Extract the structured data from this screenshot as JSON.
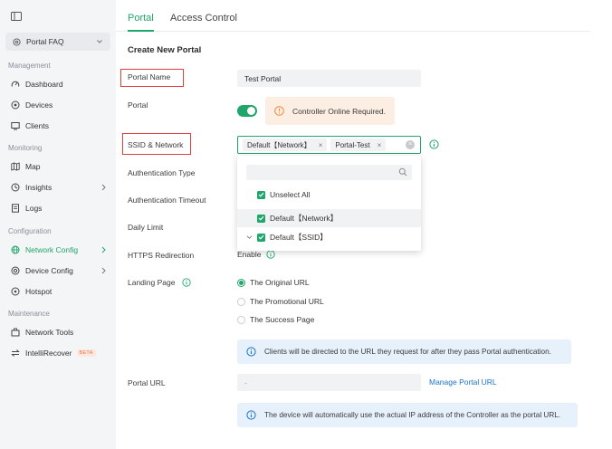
{
  "sidebar": {
    "site": "Portal FAQ",
    "sections": {
      "management": "Management",
      "monitoring": "Monitoring",
      "configuration": "Configuration",
      "maintenance": "Maintenance"
    },
    "items": {
      "dashboard": "Dashboard",
      "devices": "Devices",
      "clients": "Clients",
      "map": "Map",
      "insights": "Insights",
      "logs": "Logs",
      "network_config": "Network Config",
      "device_config": "Device Config",
      "hotspot": "Hotspot",
      "network_tools": "Network Tools",
      "intellirecover": "IntelliRecover",
      "beta": "BETA"
    },
    "active_color": "#1fa66a"
  },
  "tabs": {
    "portal": "Portal",
    "access_control": "Access Control"
  },
  "page_title": "Create New Portal",
  "form": {
    "portal_name_label": "Portal Name",
    "portal_name_value": "Test Portal",
    "portal_label": "Portal",
    "portal_enabled": true,
    "warning": "Controller Online Required.",
    "ssid_label": "SSID & Network",
    "ssid_chips": [
      "Default【Network】",
      "Portal-Test"
    ],
    "auth_type_label": "Authentication Type",
    "auth_timeout_label": "Authentication Timeout",
    "daily_limit_label": "Daily Limit",
    "https_label": "HTTPS Redirection",
    "https_enable": "Enable",
    "landing_label": "Landing Page",
    "landing_options": [
      "The Original URL",
      "The Promotional URL",
      "The Success Page"
    ],
    "landing_selected": "The Original URL",
    "landing_note": "Clients will be directed to the URL they request for after they pass Portal authentication.",
    "portal_url_label": "Portal URL",
    "portal_url_value": "-",
    "manage_portal_url": "Manage Portal URL",
    "portal_url_note": "The device will automatically use the actual IP address of the Controller as the portal URL."
  },
  "dropdown": {
    "search_placeholder": "",
    "unselect_all": "Unselect All",
    "options": [
      "Default【Network】",
      "Default【SSID】"
    ]
  },
  "colors": {
    "accent": "#1fa66a",
    "link": "#1a73c8",
    "highlight_border": "#e33e3e",
    "warning_bg": "#fdeee3",
    "info_bg": "#e7f1fb"
  }
}
